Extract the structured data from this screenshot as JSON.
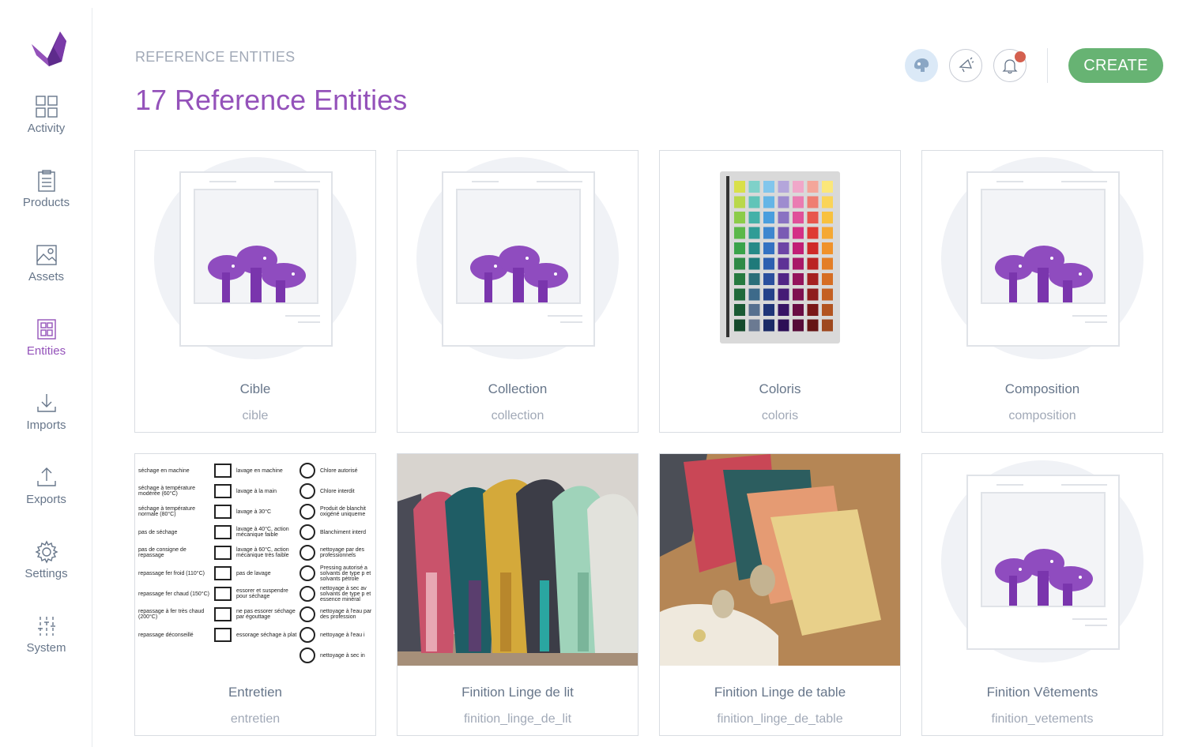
{
  "sidebar": {
    "items": [
      {
        "label": "Activity",
        "icon": "activity-grid-icon"
      },
      {
        "label": "Products",
        "icon": "clipboard-icon"
      },
      {
        "label": "Assets",
        "icon": "image-icon"
      },
      {
        "label": "Entities",
        "icon": "entities-icon",
        "active": true
      },
      {
        "label": "Imports",
        "icon": "import-icon"
      },
      {
        "label": "Exports",
        "icon": "export-icon"
      },
      {
        "label": "Settings",
        "icon": "gear-icon"
      },
      {
        "label": "System",
        "icon": "sliders-icon"
      }
    ]
  },
  "header": {
    "breadcrumb": "REFERENCE ENTITIES",
    "title": "17 Reference Entities",
    "create_label": "CREATE"
  },
  "entities": [
    {
      "label": "Cible",
      "code": "cible",
      "image": "placeholder"
    },
    {
      "label": "Collection",
      "code": "collection",
      "image": "placeholder"
    },
    {
      "label": "Coloris",
      "code": "coloris",
      "image": "color-swatches"
    },
    {
      "label": "Composition",
      "code": "composition",
      "image": "placeholder"
    },
    {
      "label": "Entretien",
      "code": "entretien",
      "image": "care-labels"
    },
    {
      "label": "Finition Linge de lit",
      "code": "finition_linge_de_lit",
      "image": "bed-linen-photo"
    },
    {
      "label": "Finition Linge de table",
      "code": "finition_linge_de_table",
      "image": "napkins-photo"
    },
    {
      "label": "Finition Vêtements",
      "code": "finition_vetements",
      "image": "placeholder"
    }
  ],
  "care_labels": {
    "left": [
      "séchage en machine",
      "séchage à température modérée (60°C)",
      "séchage à température normale (80°C)",
      "pas de séchage",
      "pas de consigne de repassage",
      "repassage fer froid (110°C)",
      "repassage fer chaud (150°C)",
      "repassage à fer très chaud (200°C)",
      "repassage déconseillé"
    ],
    "middle": [
      "lavage en machine",
      "lavage à la main",
      "lavage à 30°C",
      "lavage à 40°C, action mécanique faible",
      "lavage à 60°C, action mécanique très faible",
      "pas de lavage",
      "essorer et suspendre pour séchage",
      "ne pas essorer séchage par égouttage",
      "essorage séchage à plat"
    ],
    "right": [
      "Chlore autorisé",
      "Chlore interdit",
      "Produit de blanchit oxigéné uniqueme",
      "Blanchiment interd",
      "nettoyage par des professionnels",
      "Pressing autorisé a solvants de type p et solvants pétrole",
      "nettoyage à sec av solvants de type p et essence minéral",
      "nettoyage à l'eau par des profession",
      "nettoyage à l'eau i",
      "nettoyage à sec in"
    ]
  },
  "colors": {
    "accent": "#9452ba",
    "create": "#67b373",
    "text": "#67768a",
    "muted": "#a1a9b7",
    "notification": "#d4604f"
  }
}
